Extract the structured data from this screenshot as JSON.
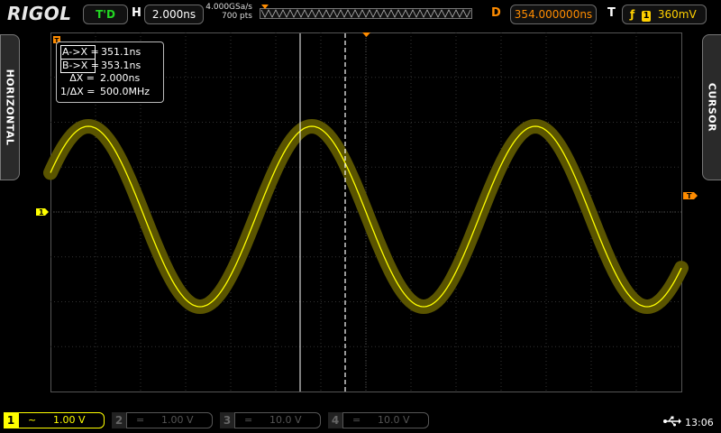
{
  "brand": "RIGOL",
  "status": "T'D",
  "horizontal": {
    "letter": "H",
    "timebase": "2.000ns",
    "sample_rate": "4.000GSa/s",
    "memory_depth": "700 pts"
  },
  "trigger_delay": {
    "letter": "D",
    "value": "354.000000ns"
  },
  "trigger": {
    "letter": "T",
    "edge_symbol": "ƒ",
    "source": "1",
    "level": "360mV"
  },
  "side_tabs": {
    "left": "HORIZONTAL",
    "right": "CURSOR"
  },
  "cursor_readout": {
    "a_label": "A->X =",
    "a_value": "351.1ns",
    "b_label": "B->X =",
    "b_value": "353.1ns",
    "dx_label": "ΔX =",
    "dx_value": "2.000ns",
    "inv_label": "1/ΔX =",
    "inv_value": "500.0MHz"
  },
  "markers": {
    "trigger_top": "T",
    "trigger_right": "T",
    "channel_left": "1"
  },
  "channels": [
    {
      "num": "1",
      "coupling": "~",
      "scale": "1.00 V",
      "active": true,
      "color": "#ffff00"
    },
    {
      "num": "2",
      "coupling": "=",
      "scale": "1.00 V",
      "active": false,
      "color": "#444444"
    },
    {
      "num": "3",
      "coupling": "=",
      "scale": "10.0 V",
      "active": false,
      "color": "#444444"
    },
    {
      "num": "4",
      "coupling": "=",
      "scale": "10.0 V",
      "active": false,
      "color": "#444444"
    }
  ],
  "clock": "13:06",
  "colors": {
    "channel1": "#ffff00",
    "trace_glow": "#5a5400",
    "delay": "#ff8c00",
    "status": "#23d623"
  }
}
